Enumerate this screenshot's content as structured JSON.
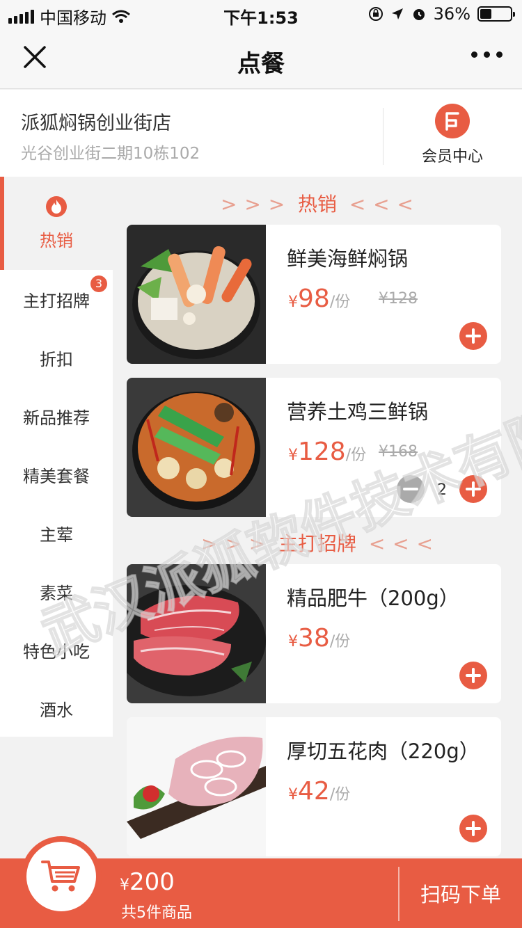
{
  "status_bar": {
    "carrier": "中国移动",
    "time": "下午1:53",
    "battery": "36%"
  },
  "nav": {
    "title": "点餐"
  },
  "store": {
    "name": "派狐焖锅创业街店",
    "address": "光谷创业街二期10栋102",
    "member_label": "会员中心"
  },
  "sidebar": {
    "items": [
      {
        "label": "热销",
        "active": true,
        "icon": "flame-icon"
      },
      {
        "label": "主打招牌",
        "badge": "3"
      },
      {
        "label": "折扣"
      },
      {
        "label": "新品推荐"
      },
      {
        "label": "精美套餐"
      },
      {
        "label": "主荤"
      },
      {
        "label": "素菜"
      },
      {
        "label": "特色小吃"
      },
      {
        "label": "酒水"
      }
    ]
  },
  "sections": [
    {
      "title": "热销",
      "arrows_left": "> > >",
      "arrows_right": "< < <"
    },
    {
      "title": "主打招牌",
      "arrows_left": "> > >",
      "arrows_right": "< < <"
    }
  ],
  "products": [
    {
      "name": "鲜美海鲜焖锅",
      "currency": "¥",
      "price": "98",
      "unit": "/份",
      "original": "¥128"
    },
    {
      "name": "营养土鸡三鲜锅",
      "currency": "¥",
      "price": "128",
      "unit": "/份",
      "original": "¥168",
      "quantity": "2"
    },
    {
      "name": "精品肥牛（200g）",
      "currency": "¥",
      "price": "38",
      "unit": "/份"
    },
    {
      "name": "厚切五花肉（220g）",
      "currency": "¥",
      "price": "42",
      "unit": "/份"
    }
  ],
  "cart": {
    "currency": "¥",
    "total": "200",
    "count_text": "共5件商品",
    "submit_label": "扫码下单"
  },
  "watermark": "武汉派狐软件技术有限公司",
  "colors": {
    "accent": "#e85c43",
    "background": "#f2f2f2"
  }
}
